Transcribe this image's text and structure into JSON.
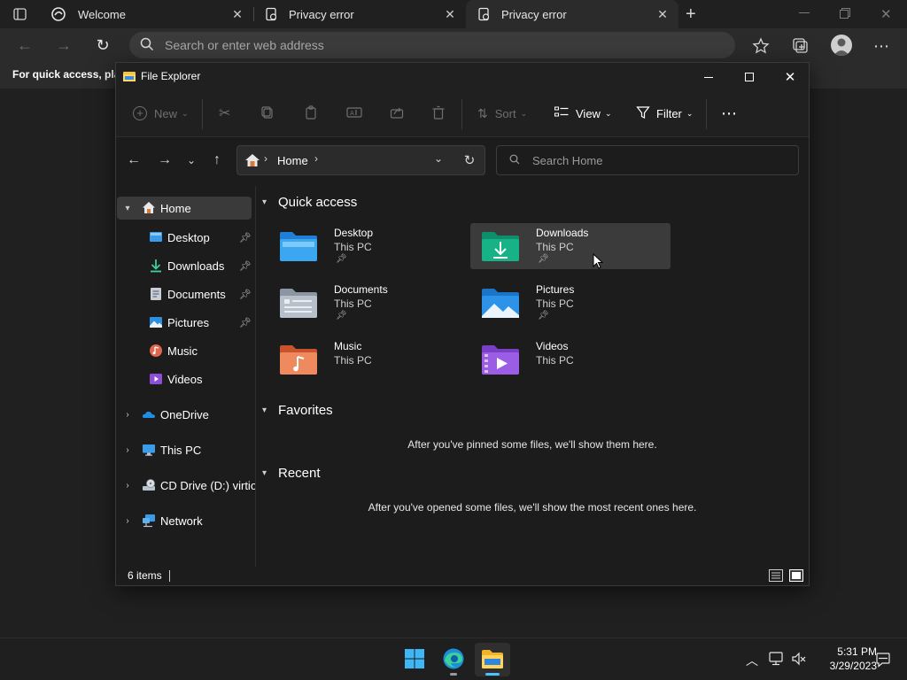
{
  "browser": {
    "tabs": [
      {
        "label": "Welcome",
        "icon": "edge-icon"
      },
      {
        "label": "Privacy error",
        "icon": "warning-page-icon"
      },
      {
        "label": "Privacy error",
        "icon": "warning-page-icon",
        "active": true
      }
    ],
    "address_placeholder": "Search or enter web address",
    "favorites_bar_text": "For quick access, plac"
  },
  "explorer": {
    "title": "File Explorer",
    "commands": {
      "new": "New",
      "sort": "Sort",
      "view": "View",
      "filter": "Filter"
    },
    "path": {
      "location": "Home"
    },
    "search_placeholder": "Search Home",
    "sidebar": {
      "home": "Home",
      "pinned": [
        {
          "label": "Desktop",
          "icon": "desktop-icon",
          "pinned": true
        },
        {
          "label": "Downloads",
          "icon": "download-icon",
          "pinned": true
        },
        {
          "label": "Documents",
          "icon": "documents-icon",
          "pinned": true
        },
        {
          "label": "Pictures",
          "icon": "pictures-icon",
          "pinned": true
        },
        {
          "label": "Music",
          "icon": "music-icon",
          "pinned": false
        },
        {
          "label": "Videos",
          "icon": "videos-icon",
          "pinned": false
        }
      ],
      "roots": [
        {
          "label": "OneDrive",
          "icon": "onedrive-icon"
        },
        {
          "label": "This PC",
          "icon": "monitor-icon"
        },
        {
          "label": "CD Drive (D:) virtio-w",
          "icon": "cd-drive-icon"
        },
        {
          "label": "Network",
          "icon": "network-icon"
        }
      ]
    },
    "quick_access": {
      "heading": "Quick access",
      "items": [
        {
          "name": "Desktop",
          "location": "This PC",
          "pinned": true,
          "icon": "desktop-folder-icon"
        },
        {
          "name": "Downloads",
          "location": "This PC",
          "pinned": true,
          "icon": "downloads-folder-icon"
        },
        {
          "name": "Documents",
          "location": "This PC",
          "pinned": true,
          "icon": "documents-folder-icon"
        },
        {
          "name": "Pictures",
          "location": "This PC",
          "pinned": true,
          "icon": "pictures-folder-icon"
        },
        {
          "name": "Music",
          "location": "This PC",
          "pinned": false,
          "icon": "music-folder-icon"
        },
        {
          "name": "Videos",
          "location": "This PC",
          "pinned": false,
          "icon": "videos-folder-icon"
        }
      ]
    },
    "favorites": {
      "heading": "Favorites",
      "empty_message": "After you've pinned some files, we'll show them here."
    },
    "recent": {
      "heading": "Recent",
      "empty_message": "After you've opened some files, we'll show the most recent ones here."
    },
    "status": {
      "items_count": "6 items"
    }
  },
  "taskbar": {
    "time": "5:31 PM",
    "date": "3/29/2023"
  }
}
